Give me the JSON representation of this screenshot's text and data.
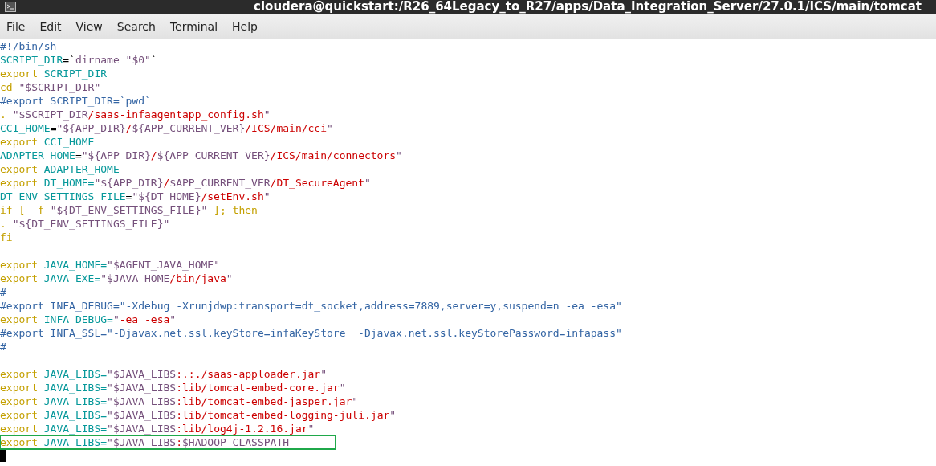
{
  "window": {
    "title": "cloudera@quickstart:/R26_64Legacy_to_R27/apps/Data_Integration_Server/27.0.1/ICS/main/tomcat"
  },
  "menu": [
    "File",
    "Edit",
    "View",
    "Search",
    "Terminal",
    "Help"
  ],
  "lines": [
    {
      "kind": "code",
      "highlighted": false,
      "segments": [
        {
          "kind": "comment",
          "text": "#!/bin/sh"
        }
      ]
    },
    {
      "kind": "code",
      "highlighted": false,
      "segments": [
        {
          "kind": "name",
          "text": "SCRIPT_DIR"
        },
        {
          "kind": "plain",
          "text": "=`"
        },
        {
          "kind": "string",
          "text": "dirname \"$0\""
        },
        {
          "kind": "plain",
          "text": "`"
        }
      ]
    },
    {
      "kind": "code",
      "highlighted": false,
      "segments": [
        {
          "kind": "keyword",
          "text": "export "
        },
        {
          "kind": "name",
          "text": "SCRIPT_DIR"
        }
      ]
    },
    {
      "kind": "code",
      "highlighted": false,
      "segments": [
        {
          "kind": "keyword",
          "text": "cd "
        },
        {
          "kind": "string",
          "text": "\"$SCRIPT_DIR\""
        }
      ]
    },
    {
      "kind": "code",
      "highlighted": false,
      "segments": [
        {
          "kind": "comment",
          "text": "#export SCRIPT_DIR=`pwd`"
        }
      ]
    },
    {
      "kind": "code",
      "highlighted": false,
      "segments": [
        {
          "kind": "keyword",
          "text": ". "
        },
        {
          "kind": "string",
          "text": "\"$SCRIPT_DIR"
        },
        {
          "kind": "path",
          "text": "/saas-infaagentapp_config.sh"
        },
        {
          "kind": "string",
          "text": "\""
        }
      ]
    },
    {
      "kind": "code",
      "highlighted": false,
      "segments": [
        {
          "kind": "name",
          "text": "CCI_HOME"
        },
        {
          "kind": "plain",
          "text": "="
        },
        {
          "kind": "string",
          "text": "\"${APP_DIR}"
        },
        {
          "kind": "path",
          "text": "/"
        },
        {
          "kind": "string",
          "text": "${APP_CURRENT_VER}"
        },
        {
          "kind": "path",
          "text": "/ICS/main/cci"
        },
        {
          "kind": "string",
          "text": "\""
        }
      ]
    },
    {
      "kind": "code",
      "highlighted": false,
      "segments": [
        {
          "kind": "keyword",
          "text": "export "
        },
        {
          "kind": "name",
          "text": "CCI_HOME"
        }
      ]
    },
    {
      "kind": "code",
      "highlighted": false,
      "segments": [
        {
          "kind": "name",
          "text": "ADAPTER_HOME"
        },
        {
          "kind": "plain",
          "text": "="
        },
        {
          "kind": "string",
          "text": "\"${APP_DIR}"
        },
        {
          "kind": "path",
          "text": "/"
        },
        {
          "kind": "string",
          "text": "${APP_CURRENT_VER}"
        },
        {
          "kind": "path",
          "text": "/ICS/main/connectors"
        },
        {
          "kind": "string",
          "text": "\""
        }
      ]
    },
    {
      "kind": "code",
      "highlighted": false,
      "segments": [
        {
          "kind": "keyword",
          "text": "export "
        },
        {
          "kind": "name",
          "text": "ADAPTER_HOME"
        }
      ]
    },
    {
      "kind": "code",
      "highlighted": false,
      "segments": [
        {
          "kind": "keyword",
          "text": "export "
        },
        {
          "kind": "name",
          "text": "DT_HOME="
        },
        {
          "kind": "string",
          "text": "\"${APP_DIR}"
        },
        {
          "kind": "path",
          "text": "/"
        },
        {
          "kind": "string",
          "text": "$APP_CURRENT_VER"
        },
        {
          "kind": "path",
          "text": "/DT_SecureAgent"
        },
        {
          "kind": "string",
          "text": "\""
        }
      ]
    },
    {
      "kind": "code",
      "highlighted": false,
      "segments": [
        {
          "kind": "name",
          "text": "DT_ENV_SETTINGS_FILE"
        },
        {
          "kind": "plain",
          "text": "="
        },
        {
          "kind": "string",
          "text": "\"${DT_HOME}"
        },
        {
          "kind": "path",
          "text": "/setEnv.sh"
        },
        {
          "kind": "string",
          "text": "\""
        }
      ]
    },
    {
      "kind": "code",
      "highlighted": false,
      "segments": [
        {
          "kind": "keyword",
          "text": "if [ -f "
        },
        {
          "kind": "string",
          "text": "\"${DT_ENV_SETTINGS_FILE}\""
        },
        {
          "kind": "keyword",
          "text": " ]; then"
        }
      ]
    },
    {
      "kind": "code",
      "highlighted": false,
      "segments": [
        {
          "kind": "keyword",
          "text": ". "
        },
        {
          "kind": "string",
          "text": "\"${DT_ENV_SETTINGS_FILE}\""
        }
      ]
    },
    {
      "kind": "code",
      "highlighted": false,
      "segments": [
        {
          "kind": "keyword",
          "text": "fi"
        }
      ]
    },
    {
      "kind": "blank"
    },
    {
      "kind": "code",
      "highlighted": false,
      "segments": [
        {
          "kind": "keyword",
          "text": "export "
        },
        {
          "kind": "name",
          "text": "JAVA_HOME="
        },
        {
          "kind": "string",
          "text": "\"$AGENT_JAVA_HOME\""
        }
      ]
    },
    {
      "kind": "code",
      "highlighted": false,
      "segments": [
        {
          "kind": "keyword",
          "text": "export "
        },
        {
          "kind": "name",
          "text": "JAVA_EXE="
        },
        {
          "kind": "string",
          "text": "\"$JAVA_HOME"
        },
        {
          "kind": "path",
          "text": "/bin/java"
        },
        {
          "kind": "string",
          "text": "\""
        }
      ]
    },
    {
      "kind": "code",
      "highlighted": false,
      "segments": [
        {
          "kind": "comment",
          "text": "#"
        }
      ]
    },
    {
      "kind": "code",
      "highlighted": false,
      "segments": [
        {
          "kind": "comment",
          "text": "#export INFA_DEBUG=\"-Xdebug -Xrunjdwp:transport=dt_socket,address=7889,server=y,suspend=n -ea -esa\""
        }
      ]
    },
    {
      "kind": "code",
      "highlighted": false,
      "segments": [
        {
          "kind": "keyword",
          "text": "export "
        },
        {
          "kind": "name",
          "text": "INFA_DEBUG="
        },
        {
          "kind": "string",
          "text": "\""
        },
        {
          "kind": "path",
          "text": "-ea -esa"
        },
        {
          "kind": "string",
          "text": "\""
        }
      ]
    },
    {
      "kind": "code",
      "highlighted": false,
      "segments": [
        {
          "kind": "comment",
          "text": "#export INFA_SSL=\"-Djavax.net.ssl.keyStore=infaKeyStore  -Djavax.net.ssl.keyStorePassword=infapass\""
        }
      ]
    },
    {
      "kind": "code",
      "highlighted": false,
      "segments": [
        {
          "kind": "comment",
          "text": "#"
        }
      ]
    },
    {
      "kind": "blank"
    },
    {
      "kind": "code",
      "highlighted": false,
      "segments": [
        {
          "kind": "keyword",
          "text": "export "
        },
        {
          "kind": "name",
          "text": "JAVA_LIBS="
        },
        {
          "kind": "string",
          "text": "\"$JAVA_LIBS"
        },
        {
          "kind": "path",
          "text": ":.:./saas-apploader.jar"
        },
        {
          "kind": "string",
          "text": "\""
        }
      ]
    },
    {
      "kind": "code",
      "highlighted": false,
      "segments": [
        {
          "kind": "keyword",
          "text": "export "
        },
        {
          "kind": "name",
          "text": "JAVA_LIBS="
        },
        {
          "kind": "string",
          "text": "\"$JAVA_LIBS"
        },
        {
          "kind": "path",
          "text": ":lib/tomcat-embed-core.jar"
        },
        {
          "kind": "string",
          "text": "\""
        }
      ]
    },
    {
      "kind": "code",
      "highlighted": false,
      "segments": [
        {
          "kind": "keyword",
          "text": "export "
        },
        {
          "kind": "name",
          "text": "JAVA_LIBS="
        },
        {
          "kind": "string",
          "text": "\"$JAVA_LIBS"
        },
        {
          "kind": "path",
          "text": ":lib/tomcat-embed-jasper.jar"
        },
        {
          "kind": "string",
          "text": "\""
        }
      ]
    },
    {
      "kind": "code",
      "highlighted": false,
      "segments": [
        {
          "kind": "keyword",
          "text": "export "
        },
        {
          "kind": "name",
          "text": "JAVA_LIBS="
        },
        {
          "kind": "string",
          "text": "\"$JAVA_LIBS"
        },
        {
          "kind": "path",
          "text": ":lib/tomcat-embed-logging-juli.jar"
        },
        {
          "kind": "string",
          "text": "\""
        }
      ]
    },
    {
      "kind": "code",
      "highlighted": false,
      "segments": [
        {
          "kind": "keyword",
          "text": "export "
        },
        {
          "kind": "name",
          "text": "JAVA_LIBS="
        },
        {
          "kind": "string",
          "text": "\"$JAVA_LIBS"
        },
        {
          "kind": "path",
          "text": ":lib/log4j-1.2.16.jar"
        },
        {
          "kind": "string",
          "text": "\""
        }
      ]
    },
    {
      "kind": "code",
      "highlighted": true,
      "segments": [
        {
          "kind": "keyword",
          "text": "export "
        },
        {
          "kind": "name",
          "text": "JAVA_LIBS="
        },
        {
          "kind": "string",
          "text": "\"$JAVA_LIBS"
        },
        {
          "kind": "path",
          "text": ":"
        },
        {
          "kind": "string",
          "text": "$HADOOP_CLASSPATH"
        }
      ]
    }
  ]
}
